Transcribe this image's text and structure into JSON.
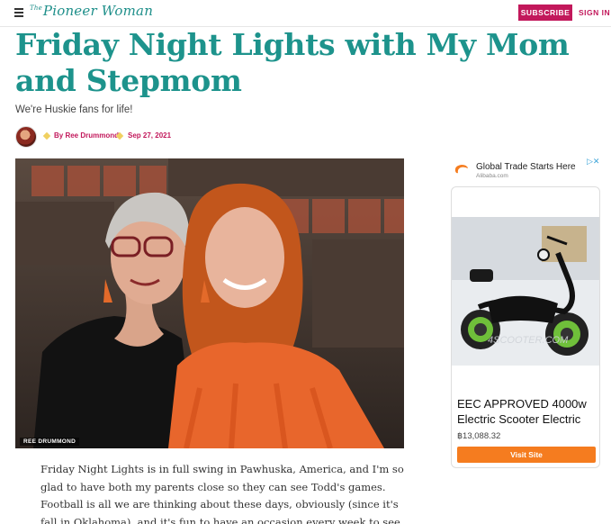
{
  "header": {
    "logo_prefix": "The",
    "logo_text": "Pioneer Woman",
    "subscribe_label": "SUBSCRIBE",
    "signin_label": "SIGN IN"
  },
  "article": {
    "title": "Friday Night Lights with My Mom and Stepmom",
    "subtitle": "We're Huskie fans for life!",
    "author": "By Ree Drummond",
    "date": "Sep 27, 2021",
    "photo_credit": "REE DRUMMOND",
    "body": "Friday Night Lights is in full swing in Pawhuska, America, and I'm so glad to have both my parents close so they can see Todd's games. Football is all we are thinking about these days, obviously (since it's fall in Oklahoma), and it's fun to have an occasion every week to see the parental units."
  },
  "ad": {
    "headline": "Global Trade Starts Here",
    "source": "Alibaba.com",
    "choices": "▷✕",
    "image_watermark": "4SCOOTER.COM",
    "title": "EEC APPROVED 4000w Electric Scooter Electric",
    "price": "฿13,088.32",
    "button": "Visit Site"
  },
  "colors": {
    "brand_teal": "#1d938c",
    "accent_pink": "#c2185b",
    "ad_button": "#f57c1f"
  }
}
